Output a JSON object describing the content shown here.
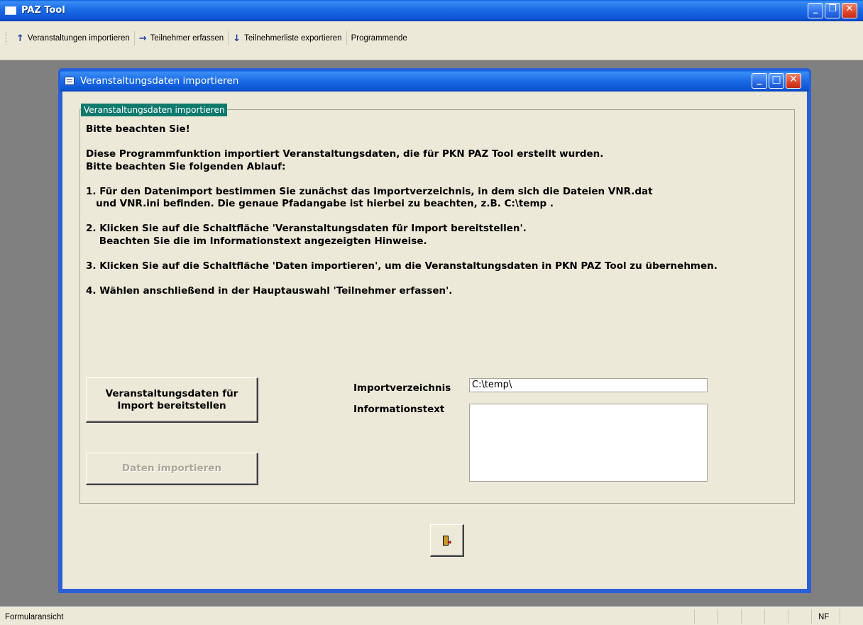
{
  "app": {
    "title": "PAZ Tool"
  },
  "toolbar": {
    "items": [
      {
        "label": "Veranstaltungen importieren",
        "icon": "arrow-up-icon"
      },
      {
        "label": "Teilnehmer erfassen",
        "icon": "arrow-right-icon"
      },
      {
        "label": "Teilnehmerliste exportieren",
        "icon": "arrow-down-icon"
      },
      {
        "label": "Programmende",
        "icon": ""
      }
    ]
  },
  "form": {
    "title": "Veranstaltungsdaten importieren",
    "group_label": "Veranstaltungsdaten importieren",
    "instructions": [
      "Bitte beachten Sie!",
      "Diese Programmfunktion importiert Veranstaltungsdaten, die für PKN PAZ Tool erstellt wurden.",
      "Bitte beachten Sie folgenden Ablauf:",
      "1. Für den Datenimport bestimmen Sie zunächst das Importverzeichnis, in dem sich die Dateien VNR.dat",
      "   und VNR.ini befinden. Die genaue Pfadangabe ist hierbei zu beachten, z.B. C:\\temp .",
      "2. Klicken Sie auf die Schaltfläche 'Veranstaltungsdaten für Import bereitstellen'.",
      "    Beachten Sie die im Informationstext angezeigten Hinweise.",
      "3. Klicken Sie auf die Schaltfläche 'Daten importieren', um die Veranstaltungsdaten in PKN PAZ Tool zu übernehmen.",
      "4. Wählen anschließend in der Hauptauswahl 'Teilnehmer erfassen'."
    ],
    "prepare_button_line1": "Veranstaltungsdaten für",
    "prepare_button_line2": "Import bereitstellen",
    "import_button": "Daten importieren",
    "import_dir_label": "Importverzeichnis",
    "import_dir_value": "C:\\temp\\",
    "info_label": "Informationstext",
    "info_value": ""
  },
  "statusbar": {
    "text": "Formularansicht",
    "indicator": "NF"
  }
}
